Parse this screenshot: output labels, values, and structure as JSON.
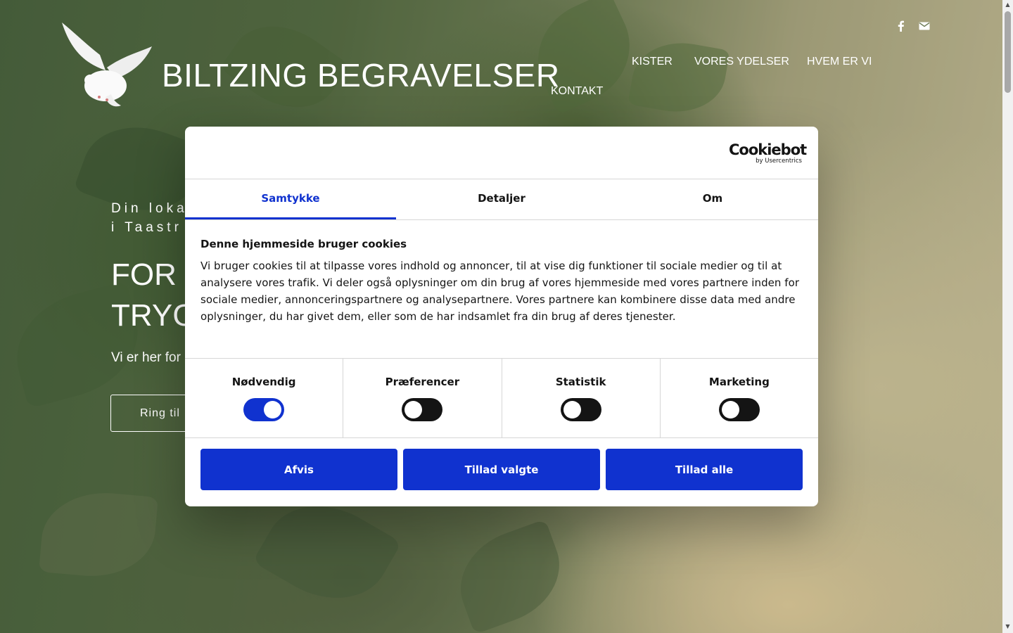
{
  "site": {
    "brand": "BILTZING BEGRAVELSER",
    "nav": [
      {
        "label": "KISTER"
      },
      {
        "label": "VORES YDELSER"
      },
      {
        "label": "HVEM ER VI"
      },
      {
        "label": "KONTAKT"
      }
    ],
    "social": [
      "facebook-icon",
      "mail-icon"
    ]
  },
  "hero": {
    "kicker": "Din loka\ni Taastr",
    "title": "FOR I\nTRYG",
    "subtitle": "Vi er her for",
    "button": "Ring til"
  },
  "cookie_dialog": {
    "provider_logo": "Cookiebot",
    "provider_by": "by Usercentrics",
    "tabs": [
      {
        "label": "Samtykke",
        "active": true
      },
      {
        "label": "Detaljer",
        "active": false
      },
      {
        "label": "Om",
        "active": false
      }
    ],
    "heading": "Denne hjemmeside bruger cookies",
    "text": "Vi bruger cookies til at tilpasse vores indhold og annoncer, til at vise dig funktioner til sociale medier og til at analysere vores trafik. Vi deler også oplysninger om din brug af vores hjemmeside med vores partnere inden for sociale medier, annonceringspartnere og analysepartnere. Vores partnere kan kombinere disse data med andre oplysninger, du har givet dem, eller som de har indsamlet fra din brug af deres tjenester.",
    "categories": [
      {
        "label": "Nødvendig",
        "checked": true
      },
      {
        "label": "Præferencer",
        "checked": false
      },
      {
        "label": "Statistik",
        "checked": false
      },
      {
        "label": "Marketing",
        "checked": false
      }
    ],
    "buttons": {
      "reject": "Afvis",
      "allow_selected": "Tillad valgte",
      "allow_all": "Tillad alle"
    },
    "accent_color": "#1032cf"
  }
}
